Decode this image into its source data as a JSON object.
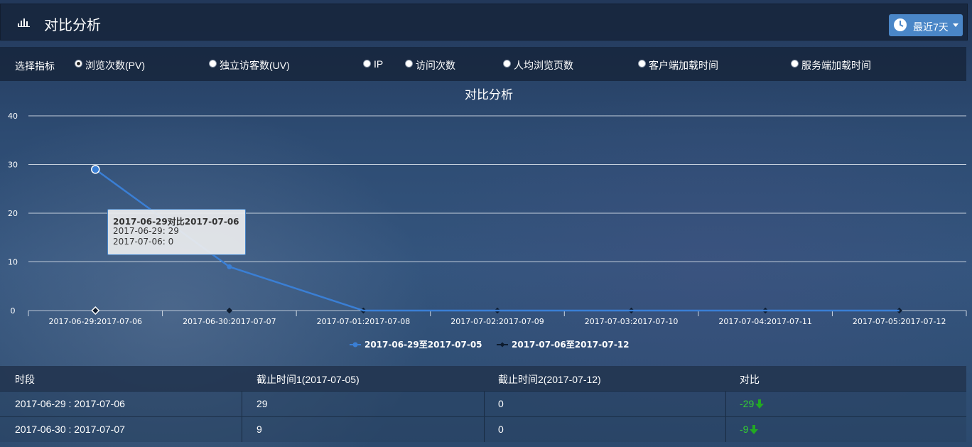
{
  "header": {
    "title": "对比分析",
    "range_label": "最近7天"
  },
  "metrics": {
    "label": "选择指标",
    "options": [
      {
        "label": "浏览次数(PV)",
        "checked": true
      },
      {
        "label": "独立访客数(UV)",
        "checked": false
      },
      {
        "label": "IP",
        "checked": false
      },
      {
        "label": "访问次数",
        "checked": false
      },
      {
        "label": "人均浏览页数",
        "checked": false
      },
      {
        "label": "客户端加载时间",
        "checked": false
      },
      {
        "label": "服务端加载时间",
        "checked": false
      }
    ]
  },
  "chart_data": {
    "type": "line",
    "title": "对比分析",
    "categories": [
      "2017-06-29:2017-07-06",
      "2017-06-30:2017-07-07",
      "2017-07-01:2017-07-08",
      "2017-07-02:2017-07-09",
      "2017-07-03:2017-07-10",
      "2017-07-04:2017-07-11",
      "2017-07-05:2017-07-12"
    ],
    "series": [
      {
        "name": "2017-06-29至2017-07-05",
        "values": [
          29,
          9,
          0,
          0,
          0,
          0,
          0
        ],
        "color": "#3a7fd5"
      },
      {
        "name": "2017-07-06至2017-07-12",
        "values": [
          0,
          0,
          0,
          0,
          0,
          0,
          0
        ],
        "color": "#0d1b2e"
      }
    ],
    "y_ticks": [
      0,
      10,
      20,
      30,
      40
    ],
    "ylim": [
      0,
      40
    ],
    "grid": true,
    "legend": "bottom-center"
  },
  "tooltip": {
    "title": "2017-06-29对比2017-07-06",
    "line1": "2017-06-29: 29",
    "line2": "2017-07-06: 0"
  },
  "table": {
    "headers": [
      "时段",
      "截止时间1(2017-07-05)",
      "截止时间2(2017-07-12)",
      "对比"
    ],
    "rows": [
      [
        "2017-06-29 : 2017-07-06",
        "29",
        "0",
        "-29"
      ],
      [
        "2017-06-30 : 2017-07-07",
        "9",
        "0",
        "-9"
      ]
    ]
  },
  "colors": {
    "accent": "#4a86c7",
    "down": "#33cc33"
  }
}
